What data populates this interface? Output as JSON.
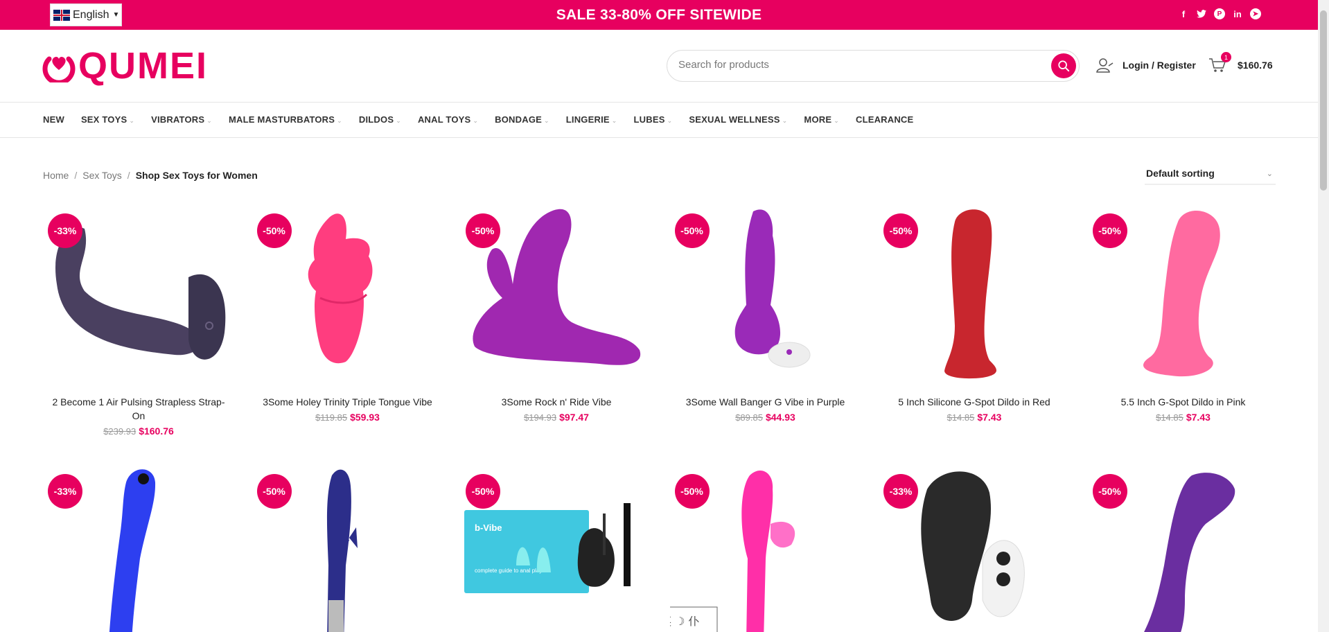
{
  "topbar": {
    "language": "English",
    "sale_text": "SALE 33-80% OFF SITEWIDE",
    "social_icons": [
      "facebook-icon",
      "twitter-icon",
      "pinterest-icon",
      "linkedin-icon",
      "telegram-icon"
    ],
    "background": "#e7005f"
  },
  "header": {
    "logo_text": "QUMEI",
    "search_placeholder": "Search for products",
    "account_label": "Login / Register",
    "cart_count": "1",
    "cart_total": "$160.76"
  },
  "nav": [
    {
      "label": "NEW",
      "dropdown": false
    },
    {
      "label": "SEX TOYS",
      "dropdown": true
    },
    {
      "label": "VIBRATORS",
      "dropdown": true
    },
    {
      "label": "MALE MASTURBATORS",
      "dropdown": true
    },
    {
      "label": "DILDOS",
      "dropdown": true
    },
    {
      "label": "ANAL TOYS",
      "dropdown": true
    },
    {
      "label": "BONDAGE",
      "dropdown": true
    },
    {
      "label": "LINGERIE",
      "dropdown": true
    },
    {
      "label": "LUBES",
      "dropdown": true
    },
    {
      "label": "SEXUAL WELLNESS",
      "dropdown": true
    },
    {
      "label": "MORE",
      "dropdown": true
    },
    {
      "label": "CLEARANCE",
      "dropdown": false
    }
  ],
  "breadcrumb": {
    "home": "Home",
    "parent": "Sex Toys",
    "current": "Shop Sex Toys for Women"
  },
  "sort": {
    "selected": "Default sorting"
  },
  "products": [
    {
      "discount": "-33%",
      "name": "2 Become 1 Air Pulsing Strapless Strap-On",
      "old_price": "$239.93",
      "price": "$160.76",
      "color": "#4a4060"
    },
    {
      "discount": "-50%",
      "name": "3Some Holey Trinity Triple Tongue Vibe",
      "old_price": "$119.85",
      "price": "$59.93",
      "color": "#ff3d7f"
    },
    {
      "discount": "-50%",
      "name": "3Some Rock n' Ride Vibe",
      "old_price": "$194.93",
      "price": "$97.47",
      "color": "#a028b0"
    },
    {
      "discount": "-50%",
      "name": "3Some Wall Banger G Vibe in Purple",
      "old_price": "$89.85",
      "price": "$44.93",
      "color": "#9a2ab8"
    },
    {
      "discount": "-50%",
      "name": "5 Inch Silicone G-Spot Dildo in Red",
      "old_price": "$14.85",
      "price": "$7.43",
      "color": "#c8262e"
    },
    {
      "discount": "-50%",
      "name": "5.5 Inch G-Spot Dildo in Pink",
      "old_price": "$14.85",
      "price": "$7.43",
      "color": "#ff6aa0"
    },
    {
      "discount": "-33%",
      "name": "",
      "old_price": "",
      "price": "",
      "color": "#2d3ff0"
    },
    {
      "discount": "-50%",
      "name": "",
      "old_price": "",
      "price": "",
      "color": "#2c2e8a"
    },
    {
      "discount": "-50%",
      "name": "",
      "old_price": "",
      "price": "",
      "color": "#40c8e0",
      "box_brand": "b-Vibe",
      "box_caption": "complete guide to anal play"
    },
    {
      "discount": "-50%",
      "name": "",
      "old_price": "",
      "price": "",
      "color": "#ff2fa8",
      "stamp": "英 ☽ 仆"
    },
    {
      "discount": "-33%",
      "name": "",
      "old_price": "",
      "price": "",
      "color": "#2a2a2a"
    },
    {
      "discount": "-50%",
      "name": "",
      "old_price": "",
      "price": "",
      "color": "#6a2ea0"
    }
  ]
}
